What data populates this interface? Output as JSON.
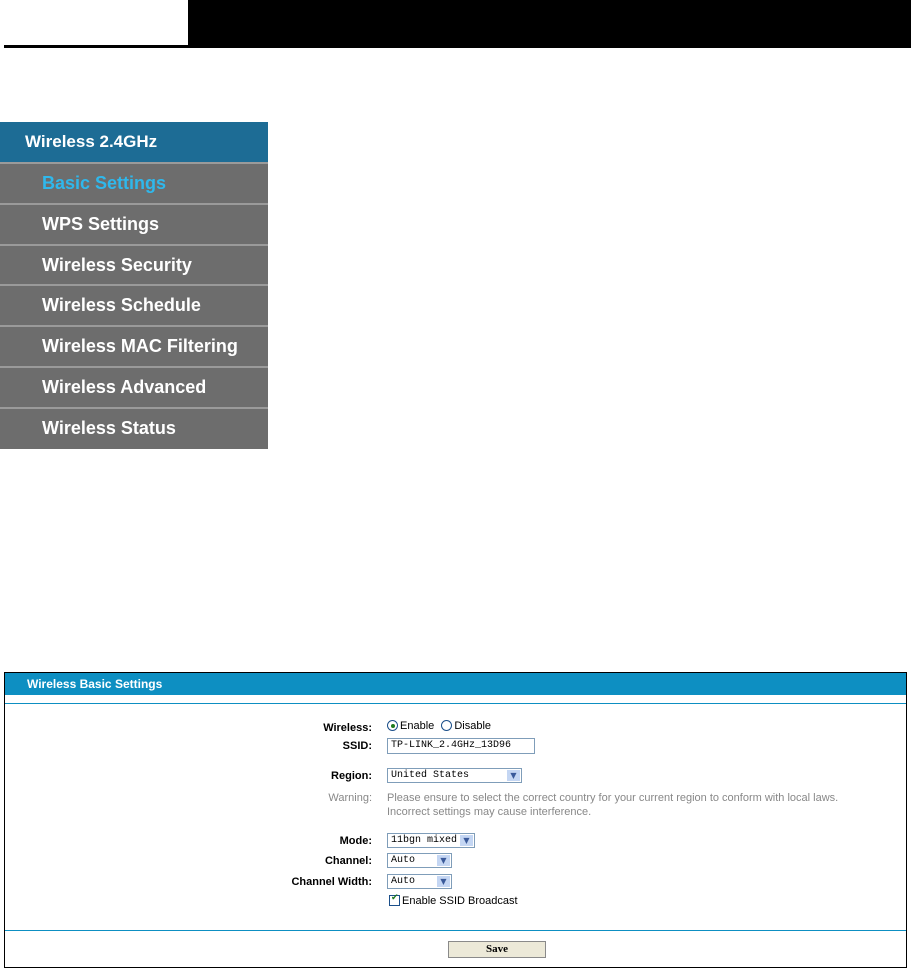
{
  "menu": {
    "header": "Wireless 2.4GHz",
    "items": [
      {
        "label": "Basic Settings",
        "active": true
      },
      {
        "label": "WPS Settings"
      },
      {
        "label": "Wireless Security"
      },
      {
        "label": "Wireless Schedule"
      },
      {
        "label": "Wireless MAC Filtering"
      },
      {
        "label": "Wireless Advanced"
      },
      {
        "label": "Wireless Status"
      }
    ]
  },
  "panel": {
    "title": "Wireless Basic Settings",
    "wireless": {
      "label": "Wireless:",
      "enable": "Enable",
      "disable": "Disable",
      "selected": "Enable"
    },
    "ssid": {
      "label": "SSID:",
      "value": "TP-LINK_2.4GHz_13D96"
    },
    "region": {
      "label": "Region:",
      "value": "United States"
    },
    "warning": {
      "label": "Warning:",
      "line1": "Please ensure to select the correct country for your current region to conform with local laws.",
      "line2": "Incorrect settings may cause interference."
    },
    "mode": {
      "label": "Mode:",
      "value": "11bgn mixed"
    },
    "channel": {
      "label": "Channel:",
      "value": "Auto"
    },
    "channel_width": {
      "label": "Channel Width:",
      "value": "Auto"
    },
    "ssid_broadcast": {
      "label": "Enable SSID Broadcast",
      "checked": true
    },
    "save_label": "Save"
  },
  "colors": {
    "menu_header": "#1d6c95",
    "menu_bg": "#6d6d6d",
    "active_item": "#2fb8ec",
    "panel_title": "#0d8fc2"
  },
  "icons": {
    "select_arrow": "chevron-down-icon",
    "radio": "radio-icon",
    "checkbox": "checkbox-icon"
  }
}
